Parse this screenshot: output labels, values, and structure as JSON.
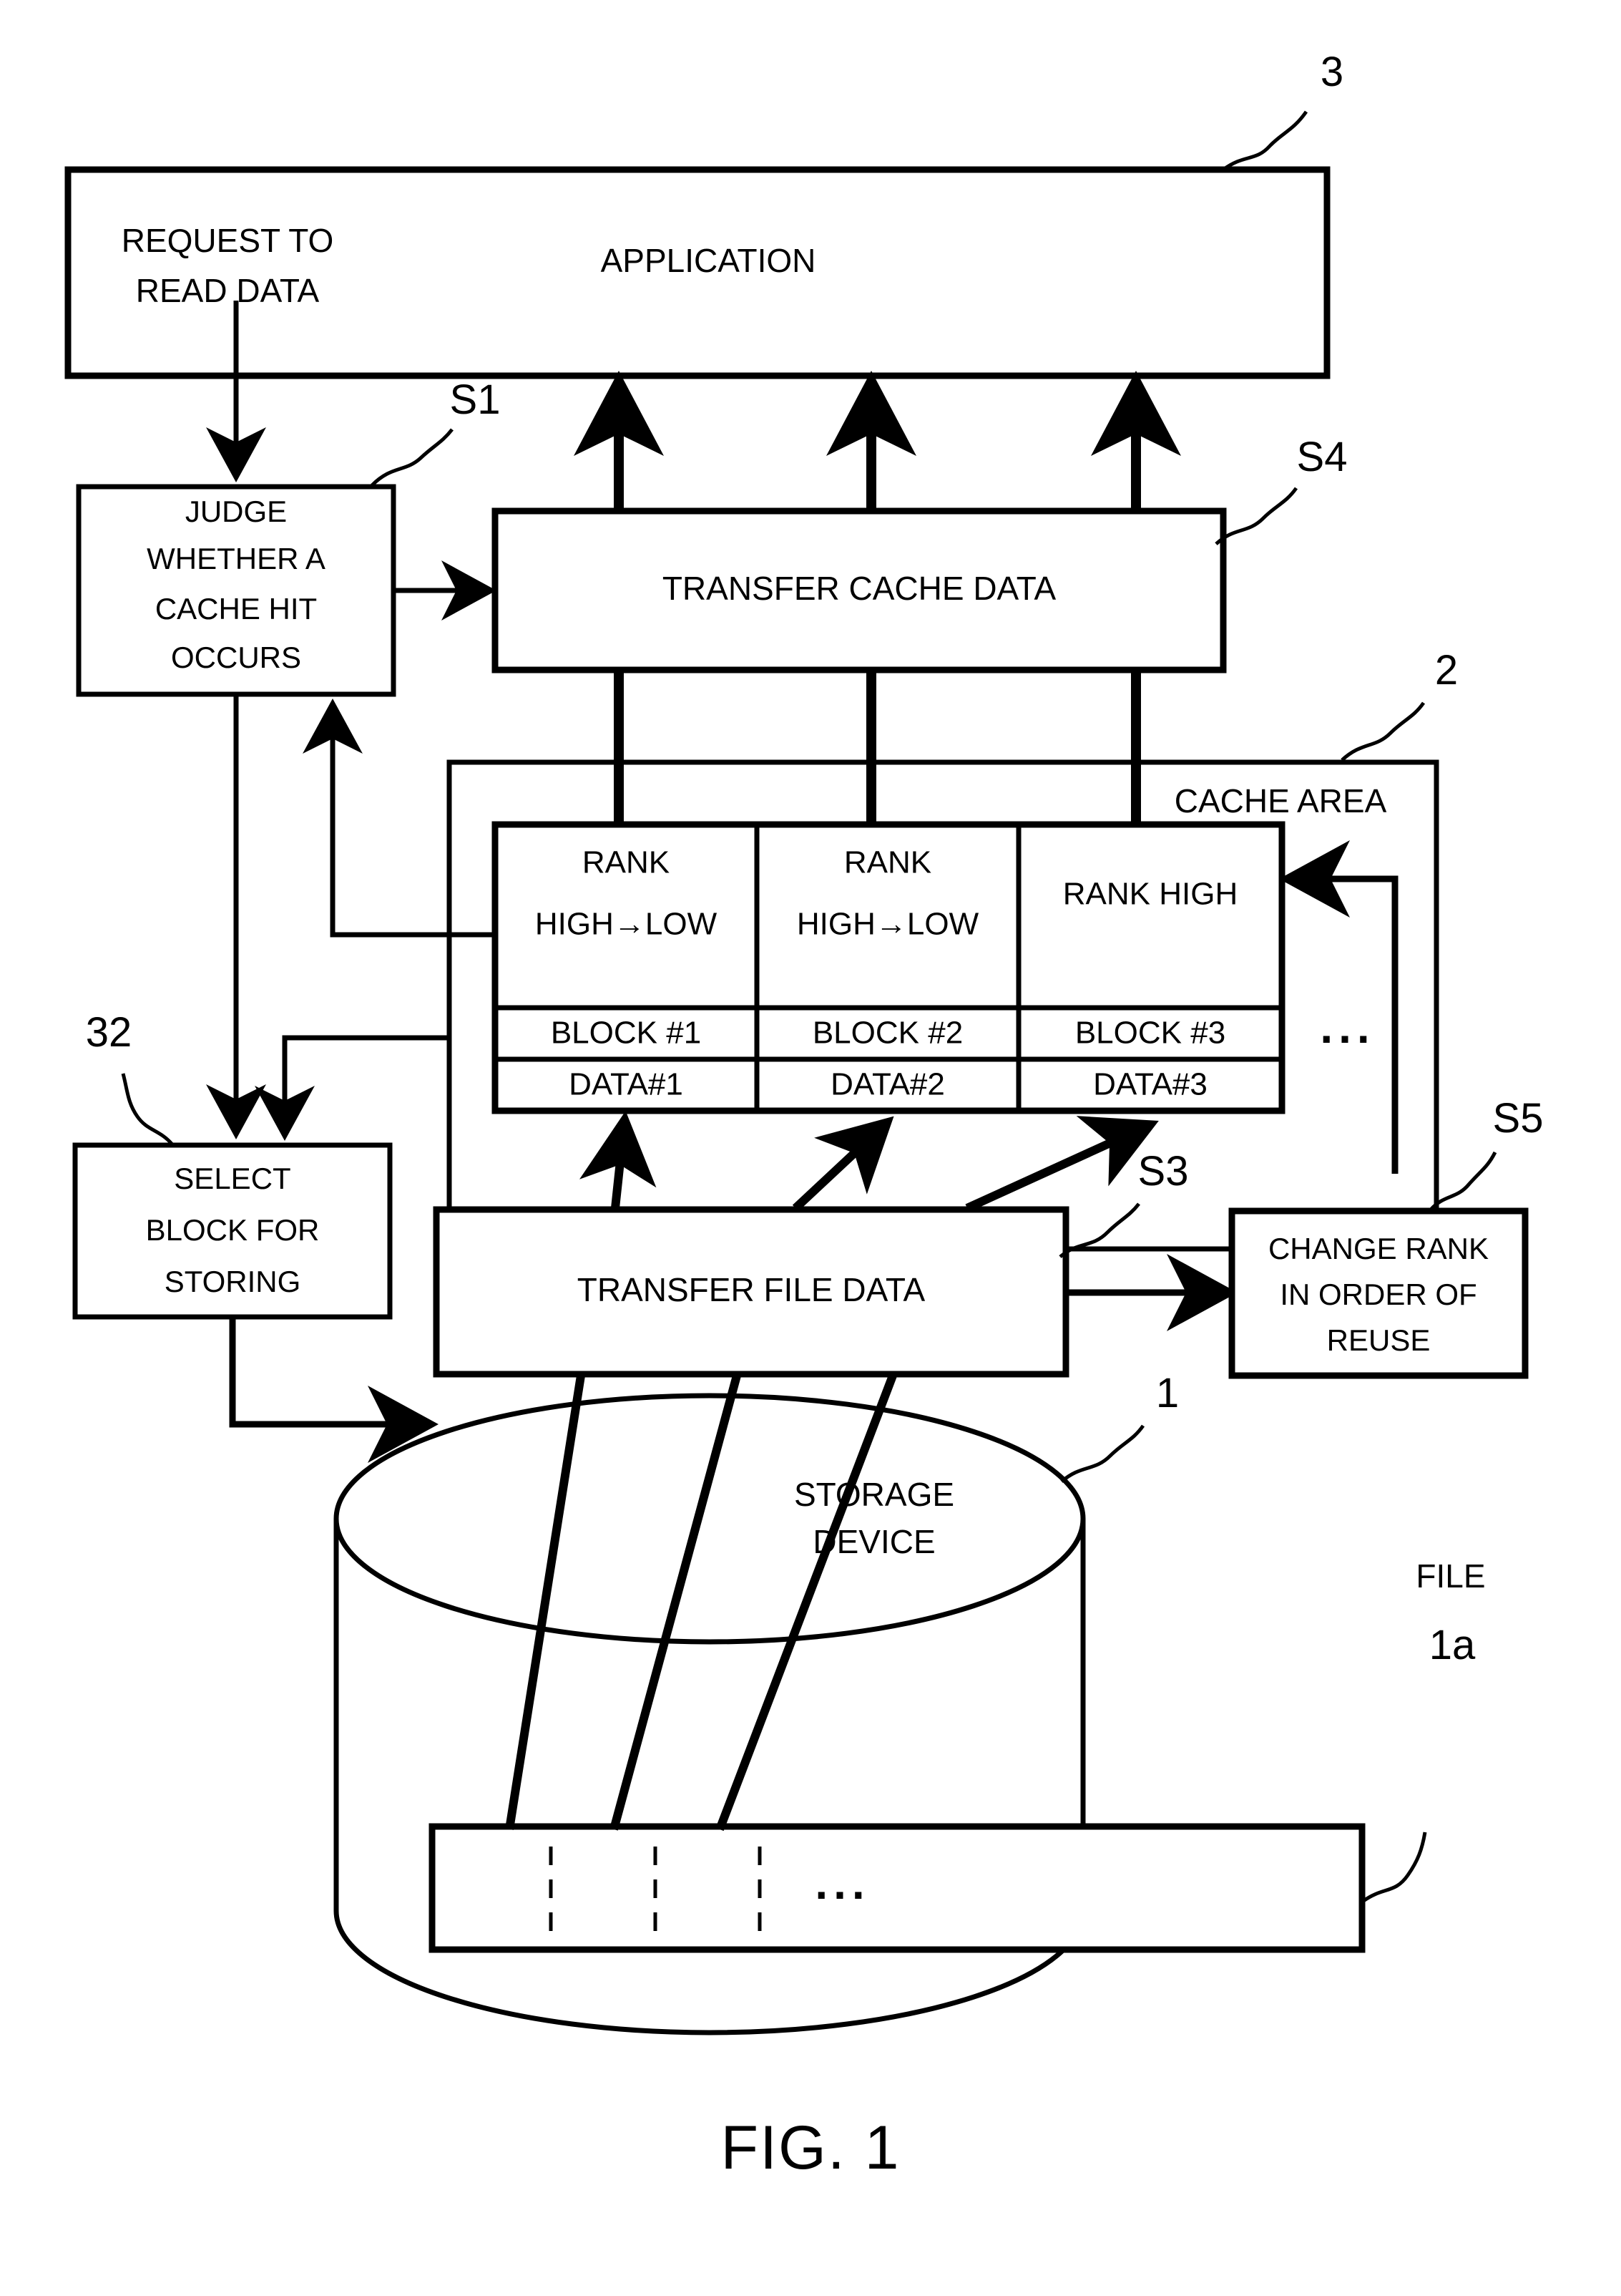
{
  "figure": {
    "caption": "FIG. 1",
    "title": "Cache read flow diagram"
  },
  "reference_labels": {
    "application": "3",
    "cache_area": "2",
    "select_block": "32",
    "storage_device": "1",
    "file": "1a",
    "step_judge": "S1",
    "step_transfer_file": "S3",
    "step_transfer_cache": "S4",
    "step_change_rank": "S5"
  },
  "boxes": {
    "application": {
      "label": "APPLICATION",
      "note": "REQUEST TO\nREAD DATA",
      "note_line1": "REQUEST TO",
      "note_line2": "READ DATA"
    },
    "judge": {
      "line1": "JUDGE",
      "line2": "WHETHER A",
      "line3": "CACHE HIT",
      "line4": "OCCURS"
    },
    "transfer_cache": {
      "label": "TRANSFER CACHE DATA"
    },
    "select_block": {
      "line1": "SELECT",
      "line2": "BLOCK FOR",
      "line3": "STORING"
    },
    "transfer_file": {
      "label": "TRANSFER FILE DATA"
    },
    "change_rank": {
      "line1": "CHANGE RANK",
      "line2": "IN ORDER OF",
      "line3": "REUSE"
    }
  },
  "cache_area": {
    "title": "CACHE AREA",
    "ellipsis": "...",
    "columns": [
      {
        "rank_line1": "RANK",
        "rank_line2": "HIGH→LOW",
        "block": "BLOCK #1",
        "data": "DATA#1"
      },
      {
        "rank_line1": "RANK",
        "rank_line2": "HIGH→LOW",
        "block": "BLOCK #2",
        "data": "DATA#2"
      },
      {
        "rank_line1": "RANK HIGH",
        "rank_line2": "",
        "block": "BLOCK #3",
        "data": "DATA#3"
      }
    ]
  },
  "storage": {
    "line1": "STORAGE",
    "line2": "DEVICE",
    "file_label": "FILE",
    "file_ellipsis": "..."
  },
  "colors": {
    "ink": "#000000",
    "paper": "#ffffff"
  }
}
